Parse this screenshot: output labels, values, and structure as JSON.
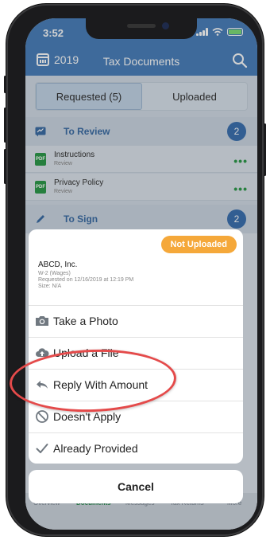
{
  "status_bar": {
    "time": "3:52"
  },
  "header": {
    "year": "2019",
    "title": "Tax Documents"
  },
  "segments": [
    {
      "label": "Requested (5)",
      "active": true
    },
    {
      "label": "Uploaded",
      "active": false
    }
  ],
  "to_review": {
    "label": "To Review",
    "count": "2",
    "documents": [
      {
        "name": "Instructions",
        "status": "Review"
      },
      {
        "name": "Privacy Policy",
        "status": "Review"
      }
    ]
  },
  "to_sign": {
    "label": "To Sign",
    "count": "2"
  },
  "pdf_label": "PDF",
  "more_dots": "•••",
  "action_sheet": {
    "status_badge": "Not Uploaded",
    "company": "ABCD, Inc.",
    "form": "W-2 (Wages)",
    "requested": "Requested on 12/16/2019 at 12:19 PM",
    "size": "Size: N/A",
    "actions": [
      {
        "label": "Take a Photo",
        "icon": "camera-icon"
      },
      {
        "label": "Upload a File",
        "icon": "cloud-upload-icon"
      },
      {
        "label": "Reply With Amount",
        "icon": "reply-icon"
      },
      {
        "label": "Doesn't Apply",
        "icon": "prohibited-icon"
      },
      {
        "label": "Already Provided",
        "icon": "checkmark-icon"
      }
    ],
    "cancel": "Cancel"
  },
  "tabbar": {
    "items": [
      {
        "label": "Overview",
        "active": false
      },
      {
        "label": "Documents",
        "active": true
      },
      {
        "label": "Messages",
        "active": false
      },
      {
        "label": "Tax Returns",
        "active": false
      },
      {
        "label": "More",
        "active": false
      }
    ]
  },
  "colors": {
    "header_blue": "#4c82bd",
    "badge_blue": "#3d73b3",
    "pill_orange": "#f5a83a",
    "pdf_green": "#2f9c4c",
    "highlight_red": "#e44a4a"
  }
}
